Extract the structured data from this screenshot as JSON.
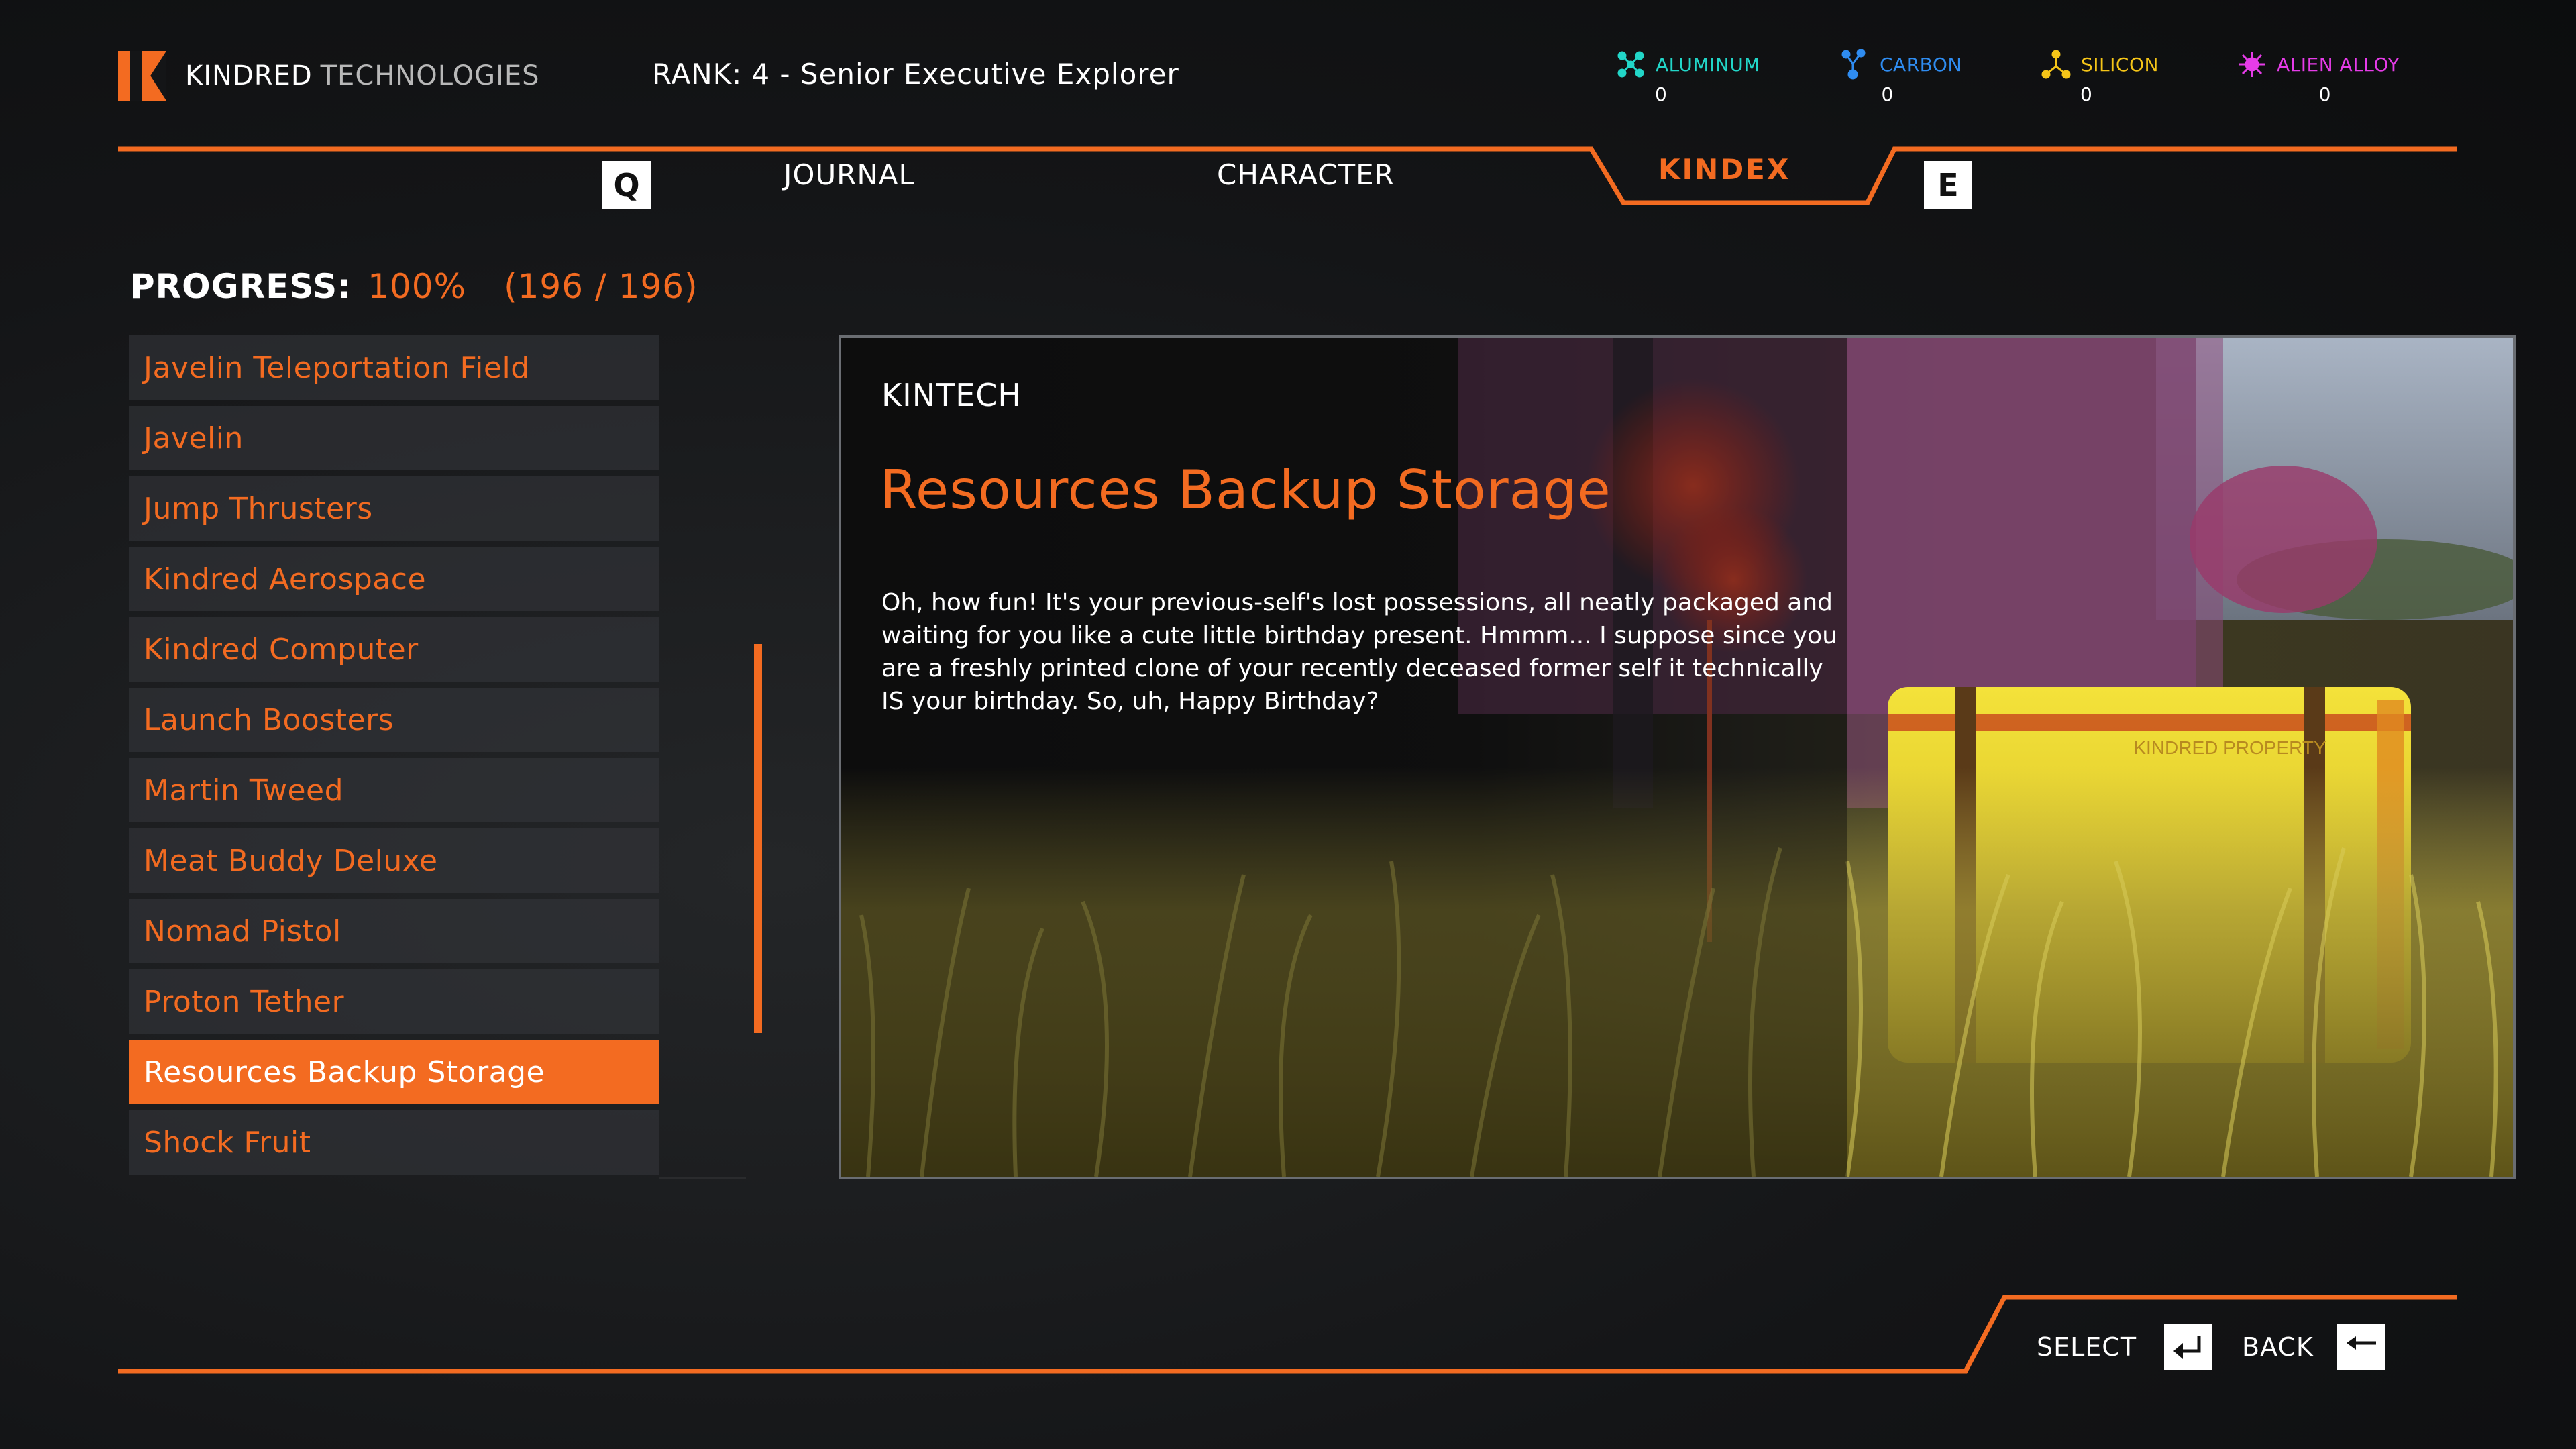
{
  "header": {
    "brand_word1": "KINDRED",
    "brand_word2": "TECHNOLOGIES",
    "rank_label": "RANK:",
    "rank_value": "4 - Senior Executive Explorer"
  },
  "resources": [
    {
      "name": "ALUMINUM",
      "value": "0",
      "color": "#22d6c8",
      "icon": "aluminum-molecule-icon"
    },
    {
      "name": "CARBON",
      "value": "0",
      "color": "#2f8cf0",
      "icon": "carbon-molecule-icon"
    },
    {
      "name": "SILICON",
      "value": "0",
      "color": "#f5c518",
      "icon": "silicon-molecule-icon"
    },
    {
      "name": "ALIEN ALLOY",
      "value": "0",
      "color": "#e63ce8",
      "icon": "alien-alloy-icon"
    }
  ],
  "tabs": {
    "prev_key": "Q",
    "next_key": "E",
    "items": [
      "JOURNAL",
      "CHARACTER",
      "KINDEX"
    ],
    "active": "KINDEX"
  },
  "progress": {
    "label": "PROGRESS:",
    "percent": "100%",
    "count": "(196 / 196)"
  },
  "entries": [
    "Javelin Teleportation Field",
    "Javelin",
    "Jump Thrusters",
    "Kindred Aerospace",
    "Kindred Computer",
    "Launch Boosters",
    "Martin Tweed",
    "Meat Buddy Deluxe",
    "Nomad Pistol",
    "Proton Tether",
    "Resources Backup Storage",
    "Shock Fruit"
  ],
  "selected_entry": "Resources Backup Storage",
  "detail": {
    "category": "KINTECH",
    "title": "Resources Backup Storage",
    "body": "Oh, how fun! It's your previous-self's lost possessions, all neatly packaged and waiting for you like a cute little birthday present. Hmmm... I suppose since you are a freshly printed clone of your recently deceased former self it technically IS your birthday. So, uh, Happy Birthday?",
    "crate_label": "KINDRED PROPERTY"
  },
  "footer": {
    "select_label": "SELECT",
    "back_label": "BACK"
  },
  "colors": {
    "accent": "#f36b21",
    "panel_border": "#6a6d72"
  }
}
